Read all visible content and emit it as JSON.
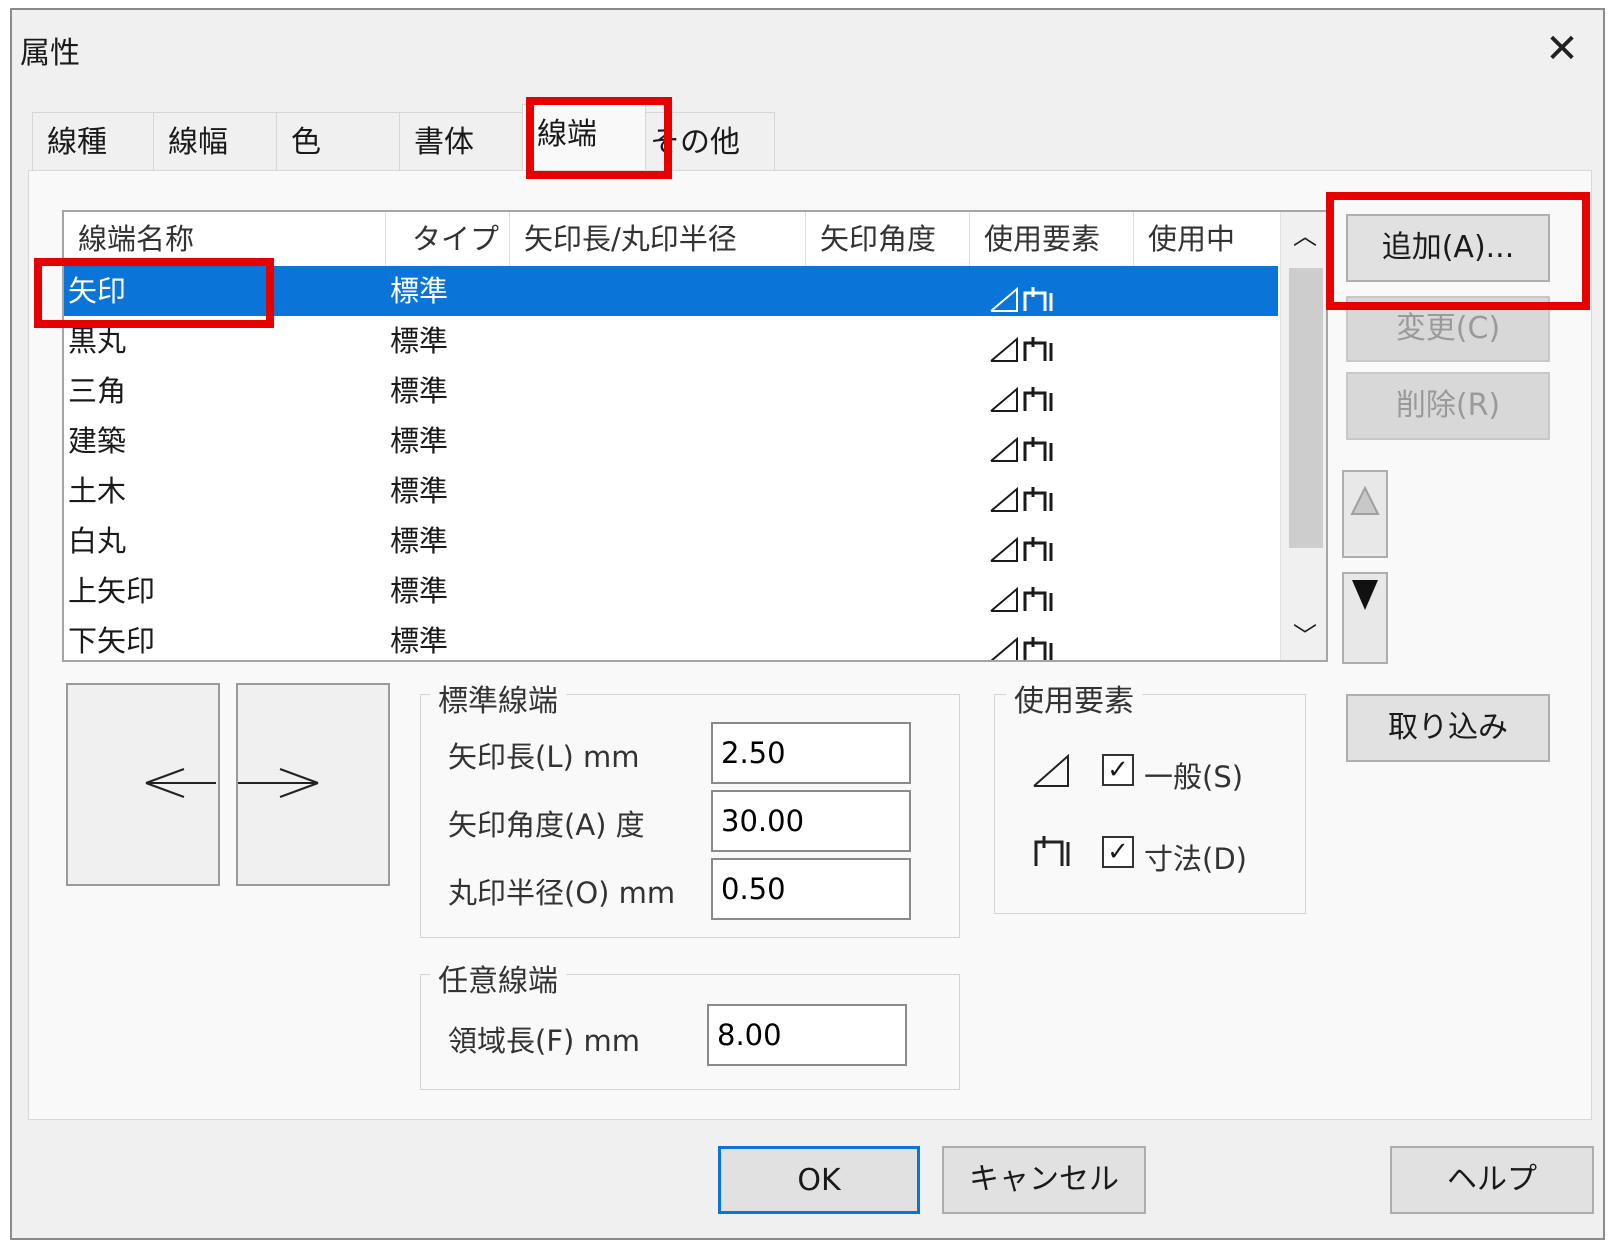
{
  "title": "属性",
  "tabs": [
    "線種",
    "線幅",
    "色",
    "書体",
    "線端",
    "その他"
  ],
  "active_tab": "線端",
  "list": {
    "columns": [
      "線端名称",
      "タイプ",
      "矢印長/丸印半径",
      "矢印角度",
      "使用要素",
      "使用中"
    ],
    "rows": [
      {
        "name": "矢印",
        "type": "標準"
      },
      {
        "name": "黒丸",
        "type": "標準"
      },
      {
        "name": "三角",
        "type": "標準"
      },
      {
        "name": "建築",
        "type": "標準"
      },
      {
        "name": "土木",
        "type": "標準"
      },
      {
        "name": "白丸",
        "type": "標準"
      },
      {
        "name": "上矢印",
        "type": "標準"
      },
      {
        "name": "下矢印",
        "type": "標準"
      }
    ]
  },
  "buttons": {
    "add": "追加(A)...",
    "change": "変更(C)",
    "delete": "削除(R)",
    "import": "取り込み",
    "ok": "OK",
    "cancel": "キャンセル",
    "help": "ヘルプ"
  },
  "standard_group": {
    "title": "標準線端",
    "arrow_length_label": "矢印長(L) mm",
    "arrow_length_value": "2.50",
    "arrow_angle_label": "矢印角度(A) 度",
    "arrow_angle_value": "30.00",
    "circle_radius_label": "丸印半径(O) mm",
    "circle_radius_value": "0.50"
  },
  "custom_group": {
    "title": "任意線端",
    "region_length_label": "領域長(F) mm",
    "region_length_value": "8.00"
  },
  "usage_group": {
    "title": "使用要素",
    "general_label": "一般(S)",
    "general_checked": true,
    "dimension_label": "寸法(D)",
    "dimension_checked": true
  },
  "colors": {
    "selection": "#0a74d8",
    "highlight_box": "#e60000"
  }
}
